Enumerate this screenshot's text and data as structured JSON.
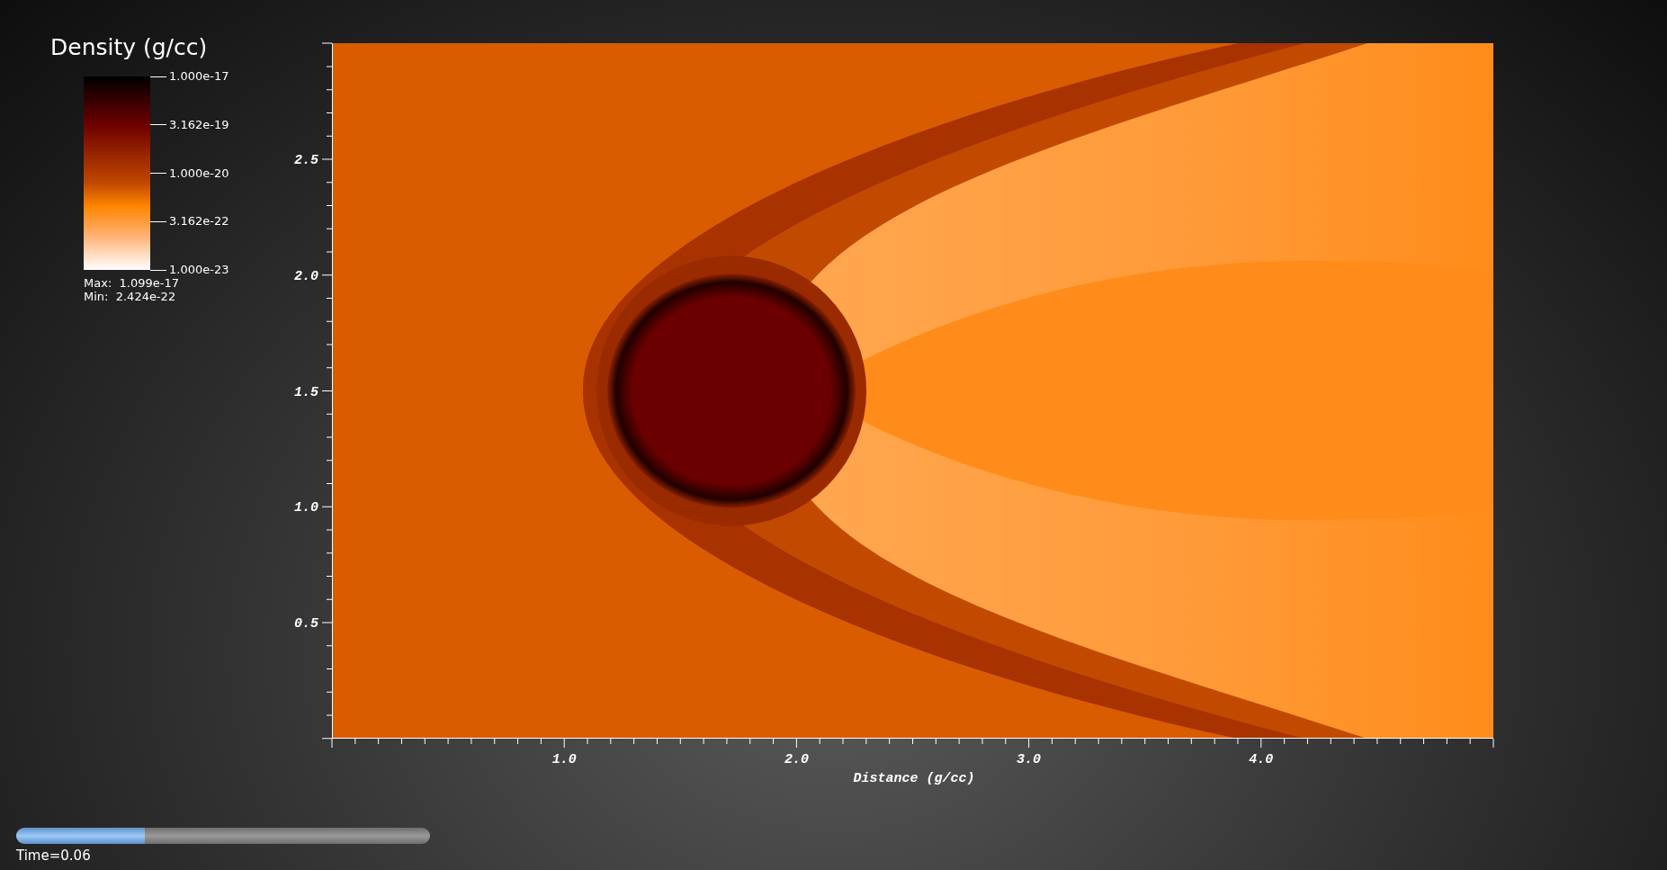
{
  "legend": {
    "title": "Density (g/cc)",
    "ticks": [
      "1.000e-17",
      "3.162e-19",
      "1.000e-20",
      "3.162e-22",
      "1.000e-23"
    ],
    "max": "Max:  1.099e-17",
    "min": "Min:  2.424e-22"
  },
  "plot": {
    "y_ticks": [
      "2.5",
      "2.0",
      "1.5",
      "1.0",
      "0.5"
    ],
    "x_ticks": [
      "1.0",
      "2.0",
      "3.0",
      "4.0"
    ],
    "xlabel": "Distance (g/cc)"
  },
  "time_slider": {
    "level": 0.31
  },
  "time_label": "Time=0.06"
}
